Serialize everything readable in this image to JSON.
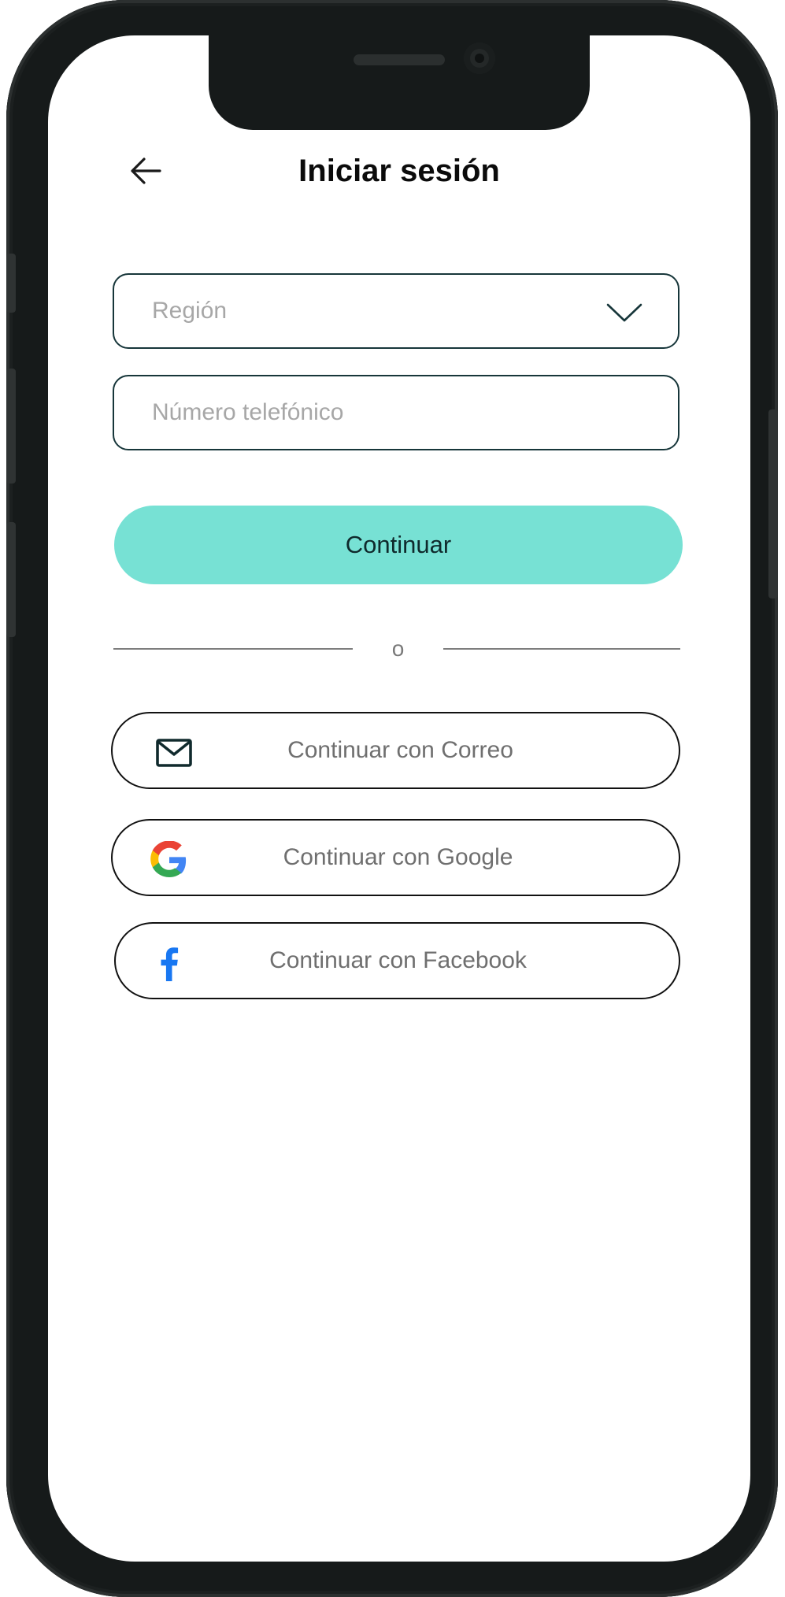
{
  "header": {
    "title": "Iniciar sesión",
    "back_icon": "arrow-left-icon"
  },
  "form": {
    "region": {
      "placeholder": "Región",
      "icon": "chevron-down-icon"
    },
    "phone": {
      "placeholder": "Número telefónico",
      "value": ""
    },
    "continue_label": "Continuar"
  },
  "divider": {
    "text": "o"
  },
  "social": {
    "email": {
      "label": "Continuar con Correo",
      "icon": "mail-icon"
    },
    "google": {
      "label": "Continuar con Google",
      "icon": "google-icon"
    },
    "facebook": {
      "label": "Continuar con Facebook",
      "icon": "facebook-icon"
    }
  },
  "colors": {
    "accent": "#77e1d4",
    "field_border": "#17363a",
    "placeholder": "#a7a7a7",
    "facebook_blue": "#1877f2",
    "google_blue": "#4285f4",
    "google_red": "#ea4335",
    "google_yellow": "#fbbc05",
    "google_green": "#34a853"
  }
}
